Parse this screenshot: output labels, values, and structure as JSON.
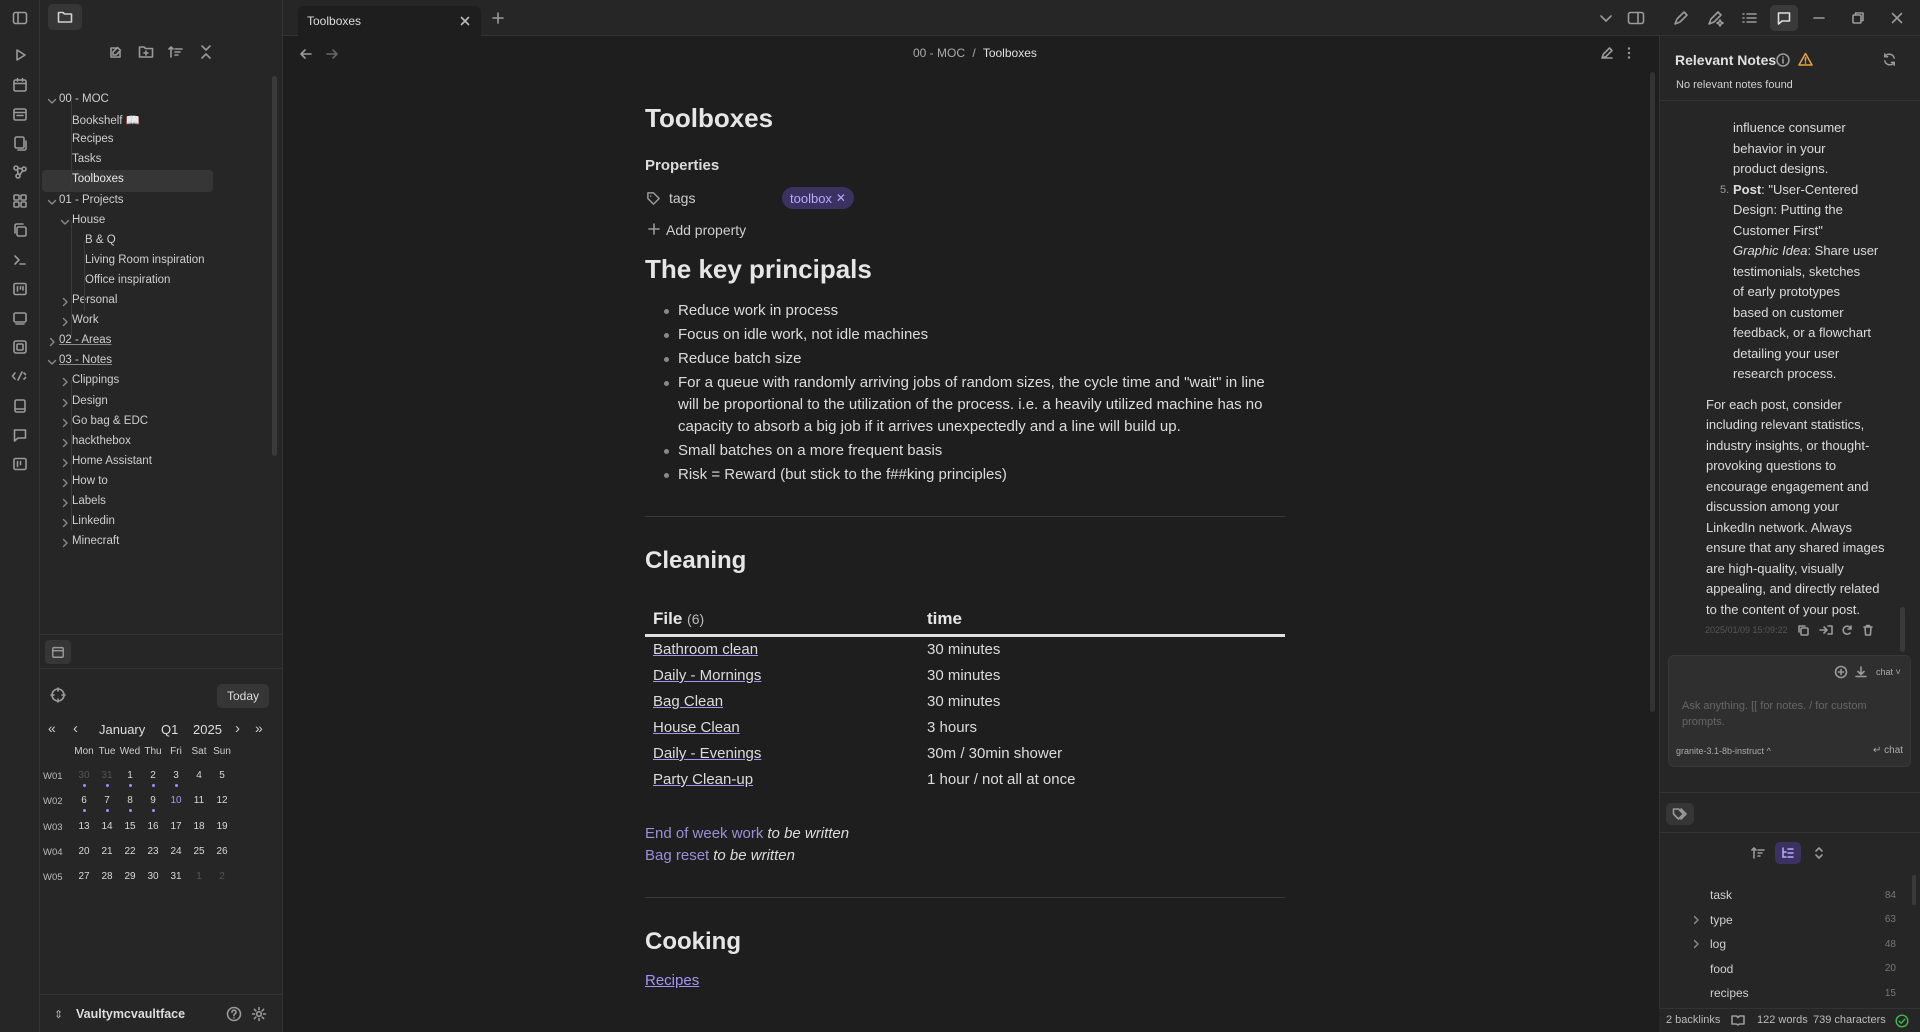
{
  "tab": {
    "title": "Toolboxes"
  },
  "breadcrumb": {
    "folder": "00 - MOC",
    "separator": "/",
    "current": "Toolboxes"
  },
  "file_tree": [
    {
      "label": "00 - MOC",
      "level": 0,
      "expanded": true
    },
    {
      "label": "Bookshelf 📖",
      "level": 1
    },
    {
      "label": "Recipes",
      "level": 1
    },
    {
      "label": "Tasks",
      "level": 1
    },
    {
      "label": "Toolboxes",
      "level": 1,
      "active": true
    },
    {
      "label": "01 - Projects",
      "level": 0,
      "expanded": true
    },
    {
      "label": "House",
      "level": 1,
      "expanded": true
    },
    {
      "label": "B & Q",
      "level": 2
    },
    {
      "label": "Living Room inspiration",
      "level": 2
    },
    {
      "label": "Office inspiration",
      "level": 2
    },
    {
      "label": "Personal",
      "level": 1,
      "collapsed": true
    },
    {
      "label": "Work",
      "level": 1,
      "collapsed": true
    },
    {
      "label": "02 - Areas",
      "level": 0,
      "collapsed": true,
      "underline": true
    },
    {
      "label": "03 - Notes",
      "level": 0,
      "expanded": true,
      "underline": true
    },
    {
      "label": "Clippings",
      "level": 1,
      "collapsed": true
    },
    {
      "label": "Design",
      "level": 1,
      "collapsed": true
    },
    {
      "label": "Go bag & EDC",
      "level": 1,
      "collapsed": true
    },
    {
      "label": "hackthebox",
      "level": 1,
      "collapsed": true
    },
    {
      "label": "Home Assistant",
      "level": 1,
      "collapsed": true
    },
    {
      "label": "How to",
      "level": 1,
      "collapsed": true
    },
    {
      "label": "Labels",
      "level": 1,
      "collapsed": true
    },
    {
      "label": "Linkedin",
      "level": 1,
      "collapsed": true
    },
    {
      "label": "Minecraft",
      "level": 1,
      "collapsed": true
    }
  ],
  "calendar": {
    "today_label": "Today",
    "month": "January",
    "quarter": "Q1",
    "year": "2025",
    "nav": {
      "first": "«",
      "prev": "‹",
      "next": "›",
      "last": "»"
    },
    "weekdays": [
      "Mon",
      "Tue",
      "Wed",
      "Thu",
      "Fri",
      "Sat",
      "Sun"
    ],
    "weeks": [
      {
        "label": "W01",
        "days": [
          "30",
          "31",
          "1",
          "2",
          "3",
          "4",
          "5"
        ],
        "muted": [
          0,
          1
        ],
        "dots": [
          0,
          1,
          2,
          3,
          4
        ]
      },
      {
        "label": "W02",
        "days": [
          "6",
          "7",
          "8",
          "9",
          "10",
          "11",
          "12"
        ],
        "muted": [],
        "dots": [
          0,
          1,
          2,
          3
        ],
        "today": 4
      },
      {
        "label": "W03",
        "days": [
          "13",
          "14",
          "15",
          "16",
          "17",
          "18",
          "19"
        ],
        "muted": [],
        "dots": []
      },
      {
        "label": "W04",
        "days": [
          "20",
          "21",
          "22",
          "23",
          "24",
          "25",
          "26"
        ],
        "muted": [],
        "dots": []
      },
      {
        "label": "W05",
        "days": [
          "27",
          "28",
          "29",
          "30",
          "31",
          "1",
          "2"
        ],
        "muted": [
          5,
          6
        ],
        "dots": []
      }
    ]
  },
  "vault": {
    "name": "Vaultymcvaultface"
  },
  "note": {
    "title": "Toolboxes",
    "properties_label": "Properties",
    "property_key": "tags",
    "tag_value": "toolbox",
    "add_property": "Add property",
    "section1_heading": "The key principals",
    "principles": [
      "Reduce work in process",
      "Focus on idle work, not idle machines",
      "Reduce batch size",
      "For a queue with randomly arriving jobs of random sizes, the cycle time and \"wait\" in line will be proportional to the utilization of the process. i.e. a heavily utilized machine has no capacity to absorb a big job if it arrives unexpectedly and a line will build up.",
      "Small batches on a more frequent basis",
      "Risk = Reward (but stick to the f##king principles)"
    ],
    "section2_heading": "Cleaning",
    "table": {
      "col_file": "File",
      "col_file_count": "(6)",
      "col_time": "time",
      "rows": [
        {
          "file": "Bathroom clean",
          "time": "30 minutes"
        },
        {
          "file": "Daily - Mornings",
          "time": "30 minutes"
        },
        {
          "file": "Bag Clean",
          "time": "30 minutes"
        },
        {
          "file": "House Clean",
          "time": "3 hours"
        },
        {
          "file": "Daily - Evenings",
          "time": "30m / 30min shower"
        },
        {
          "file": "Party Clean-up",
          "time": "1 hour / not all at once"
        }
      ]
    },
    "pending": [
      {
        "link": "End of week work",
        "note": "to be written"
      },
      {
        "link": "Bag reset",
        "note": "to be written"
      }
    ],
    "section3_heading": "Cooking",
    "cooking_link": "Recipes"
  },
  "right_panel": {
    "title": "Relevant Notes",
    "empty": "No relevant notes found",
    "chat_lines_list": [
      "influence consumer",
      "behavior in your",
      "product designs."
    ],
    "item5_number": "5.",
    "item5_lines": [
      {
        "bold": "Post",
        "text": ": \"User-Centered"
      },
      {
        "bold": "",
        "text": "Design: Putting the"
      },
      {
        "bold": "",
        "text": "Customer First\""
      }
    ],
    "graphic_lines": [
      {
        "italic": "Graphic Idea",
        "text": ": Share user"
      },
      {
        "italic": "",
        "text": "testimonials, sketches"
      },
      {
        "italic": "",
        "text": "of early prototypes"
      },
      {
        "italic": "",
        "text": "based on customer"
      },
      {
        "italic": "",
        "text": "feedback, or a flowchart"
      },
      {
        "italic": "",
        "text": "detailing your user"
      },
      {
        "italic": "",
        "text": "research process."
      }
    ],
    "paragraph_lines": [
      "For each post, consider",
      "including relevant statistics,",
      "industry insights, or thought-",
      "provoking questions to",
      "encourage engagement and",
      "discussion among your",
      "LinkedIn network. Always",
      "ensure that any shared images",
      "are high-quality, visually",
      "appealing, and directly related",
      "to the content of your post."
    ],
    "timestamp": "2025/01/09 15:09:22",
    "chat_mode": "chat",
    "input_placeholder_1": "Ask anything. [[ for notes. / for custom",
    "input_placeholder_2": "prompts.",
    "model": "granite-3.1-8b-instruct",
    "model_caret": "^",
    "send_label": "↵ chat",
    "tags": [
      {
        "name": "task",
        "count": "84",
        "expandable": false
      },
      {
        "name": "type",
        "count": "63",
        "expandable": true
      },
      {
        "name": "log",
        "count": "48",
        "expandable": true
      },
      {
        "name": "food",
        "count": "20",
        "expandable": false
      },
      {
        "name": "recipes",
        "count": "15",
        "expandable": false
      }
    ]
  },
  "status_bar": {
    "backlinks": "2 backlinks",
    "words": "122 words",
    "characters": "739 characters"
  },
  "colors": {
    "accent": "#a594f9",
    "background": "#1e1e1e",
    "panel": "#262626",
    "warning": "#e8a33d",
    "ok": "#3fb950"
  }
}
